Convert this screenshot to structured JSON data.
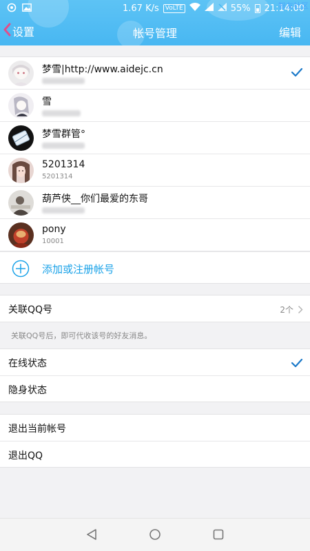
{
  "status_bar": {
    "speed": "1.67 K/s",
    "volte": "VoLTE",
    "battery": "55%",
    "time": "21:14:00",
    "watermark": "智友社区"
  },
  "header": {
    "back_label": "设置",
    "title": "帐号管理",
    "edit_label": "编辑"
  },
  "accounts": [
    {
      "name": "梦雪|http://www.aidejc.cn",
      "sub": "",
      "selected": true
    },
    {
      "name": "雪",
      "sub": "",
      "selected": false
    },
    {
      "name": "梦雪群管°",
      "sub": "",
      "selected": false
    },
    {
      "name": "5201314",
      "sub": "5201314",
      "selected": false
    },
    {
      "name": "葫芦侠__你们最爱的东哥",
      "sub": "",
      "selected": false
    },
    {
      "name": "pony",
      "sub": "10001",
      "selected": false
    }
  ],
  "add_account_label": "添加或注册帐号",
  "linked_qq": {
    "label": "关联QQ号",
    "count": "2个",
    "hint": "关联QQ号后，即可代收该号的好友消息。"
  },
  "status_options": [
    {
      "label": "在线状态",
      "selected": true
    },
    {
      "label": "隐身状态",
      "selected": false
    }
  ],
  "logout": {
    "current_label": "退出当前帐号",
    "qq_label": "退出QQ"
  },
  "colors": {
    "header_blue": "#48b7f2",
    "accent_blue": "#1aa2e8",
    "check_blue": "#1978c8"
  },
  "icons": {
    "back": "chevron-left-icon",
    "check": "check-icon",
    "add": "plus-circle-icon",
    "chevron": "chevron-right-icon"
  }
}
